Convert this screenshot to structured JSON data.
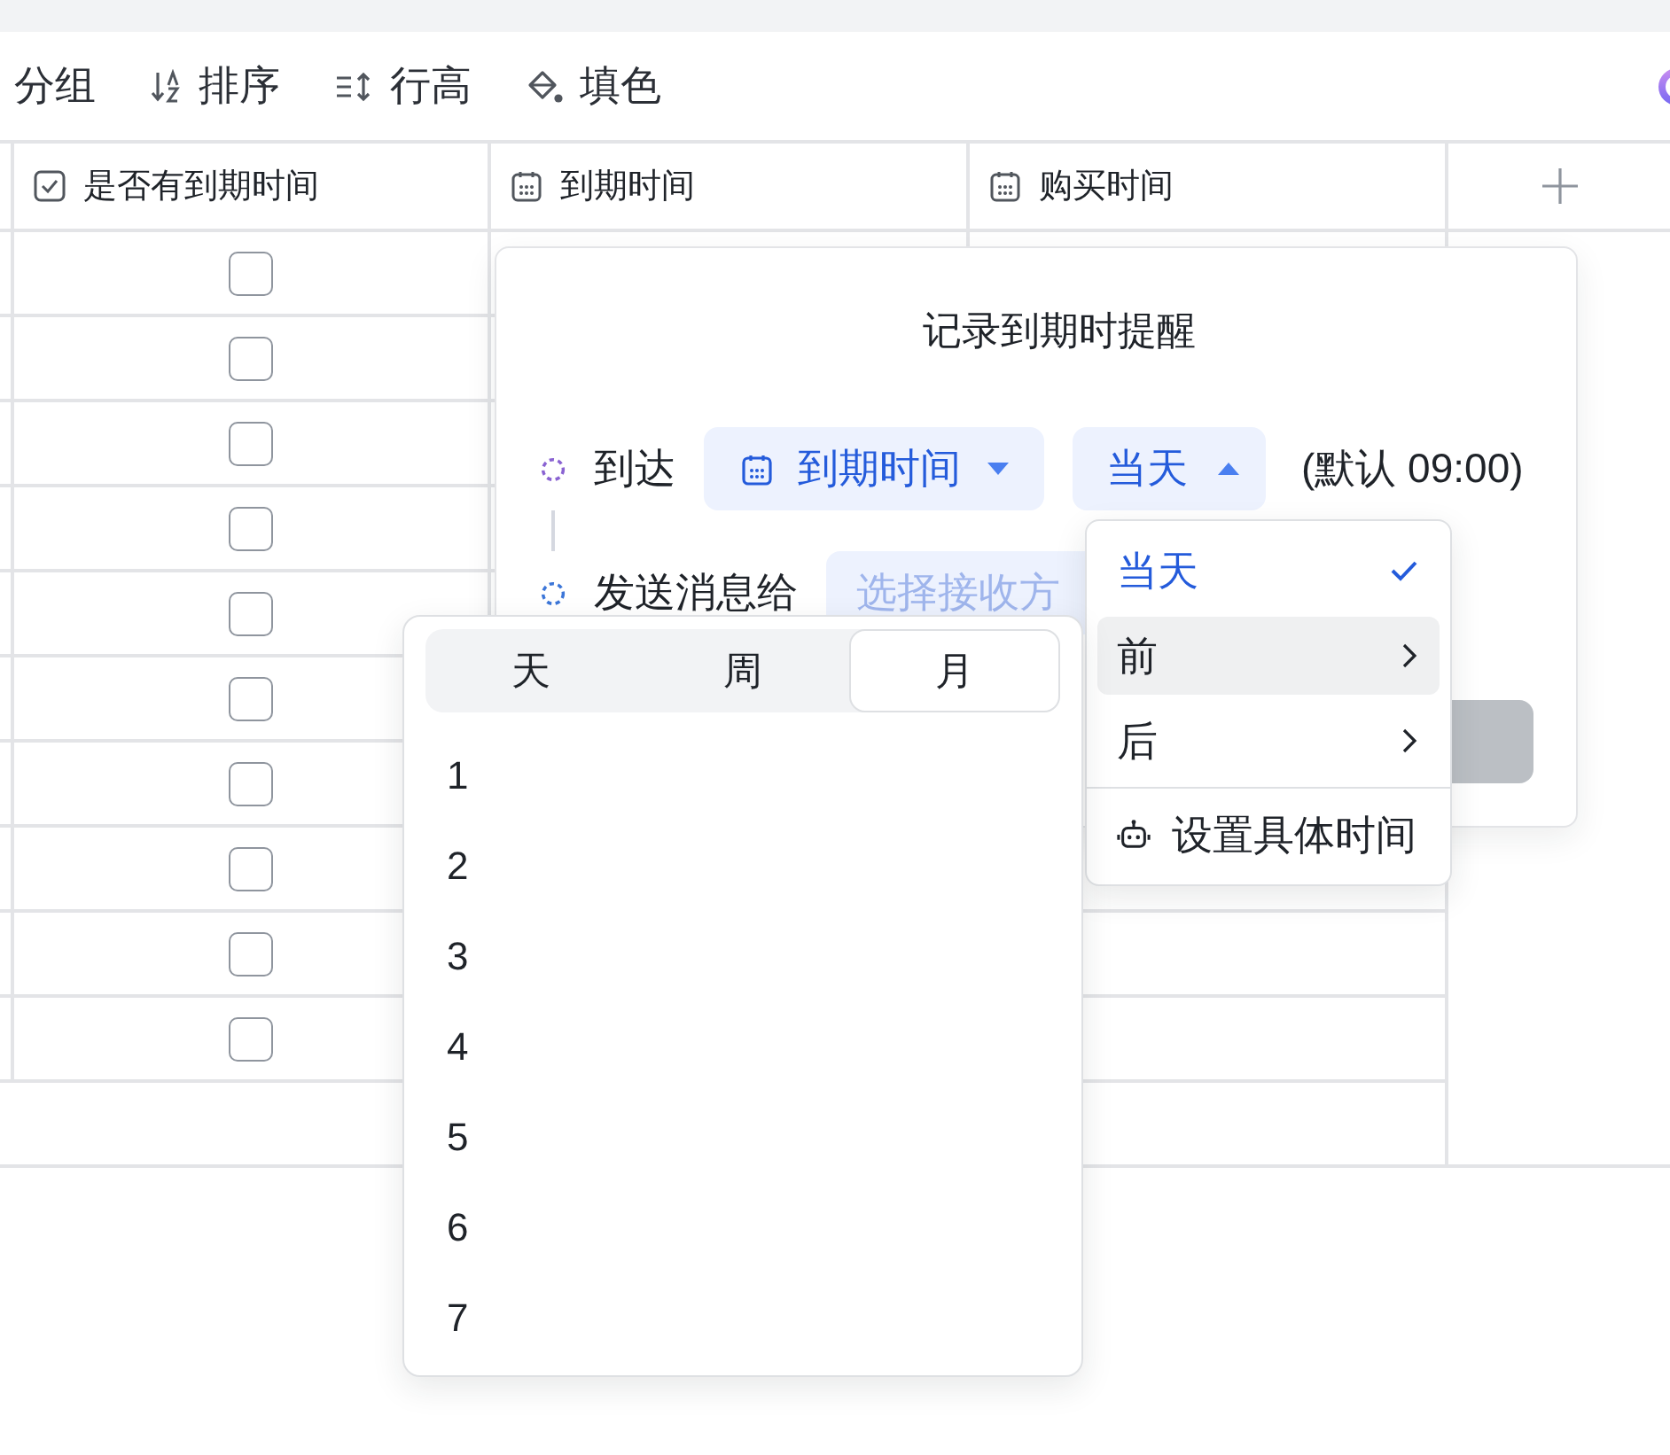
{
  "toolbar": {
    "items": [
      {
        "kind": "group",
        "label": "分组"
      },
      {
        "kind": "sort",
        "label": "排序"
      },
      {
        "kind": "row_height",
        "label": "行高"
      },
      {
        "kind": "fill",
        "label": "填色"
      }
    ]
  },
  "table": {
    "columns": [
      {
        "kind": "checkbox",
        "label": "是否有到期时间"
      },
      {
        "kind": "date",
        "label": "到期时间"
      },
      {
        "kind": "date",
        "label": "购买时间"
      }
    ],
    "rows": [
      {
        "checked": false
      },
      {
        "checked": false
      },
      {
        "checked": false
      },
      {
        "checked": false
      },
      {
        "checked": false
      },
      {
        "checked": false
      },
      {
        "checked": false
      },
      {
        "checked": false
      },
      {
        "checked": false
      },
      {
        "checked": false
      }
    ]
  },
  "reminder": {
    "title": "记录到期时提醒",
    "steps": [
      {
        "kind": "trigger",
        "color": "#8a63d2",
        "label": "到达",
        "field": "到期时间",
        "timing": "当天",
        "timing_open": true,
        "note": "(默认 09:00)"
      },
      {
        "kind": "action",
        "color": "#3c76d8",
        "label": "发送消息给",
        "placeholder": "选择接收方"
      }
    ],
    "confirm_button": {
      "disabled": true
    }
  },
  "timing_menu": {
    "items": [
      {
        "kind": "option",
        "label": "当天",
        "selected": true,
        "highlighted": false
      },
      {
        "kind": "submenu",
        "label": "前",
        "selected": false,
        "highlighted": true
      },
      {
        "kind": "submenu",
        "label": "后",
        "selected": false,
        "highlighted": false
      },
      {
        "kind": "action",
        "label": "设置具体时间",
        "selected": false,
        "highlighted": false
      }
    ]
  },
  "unit_picker": {
    "tabs": [
      {
        "label": "天",
        "selected": false
      },
      {
        "label": "周",
        "selected": false
      },
      {
        "label": "月",
        "selected": true
      }
    ],
    "options": [
      "1",
      "2",
      "3",
      "4",
      "5",
      "6",
      "7"
    ]
  }
}
